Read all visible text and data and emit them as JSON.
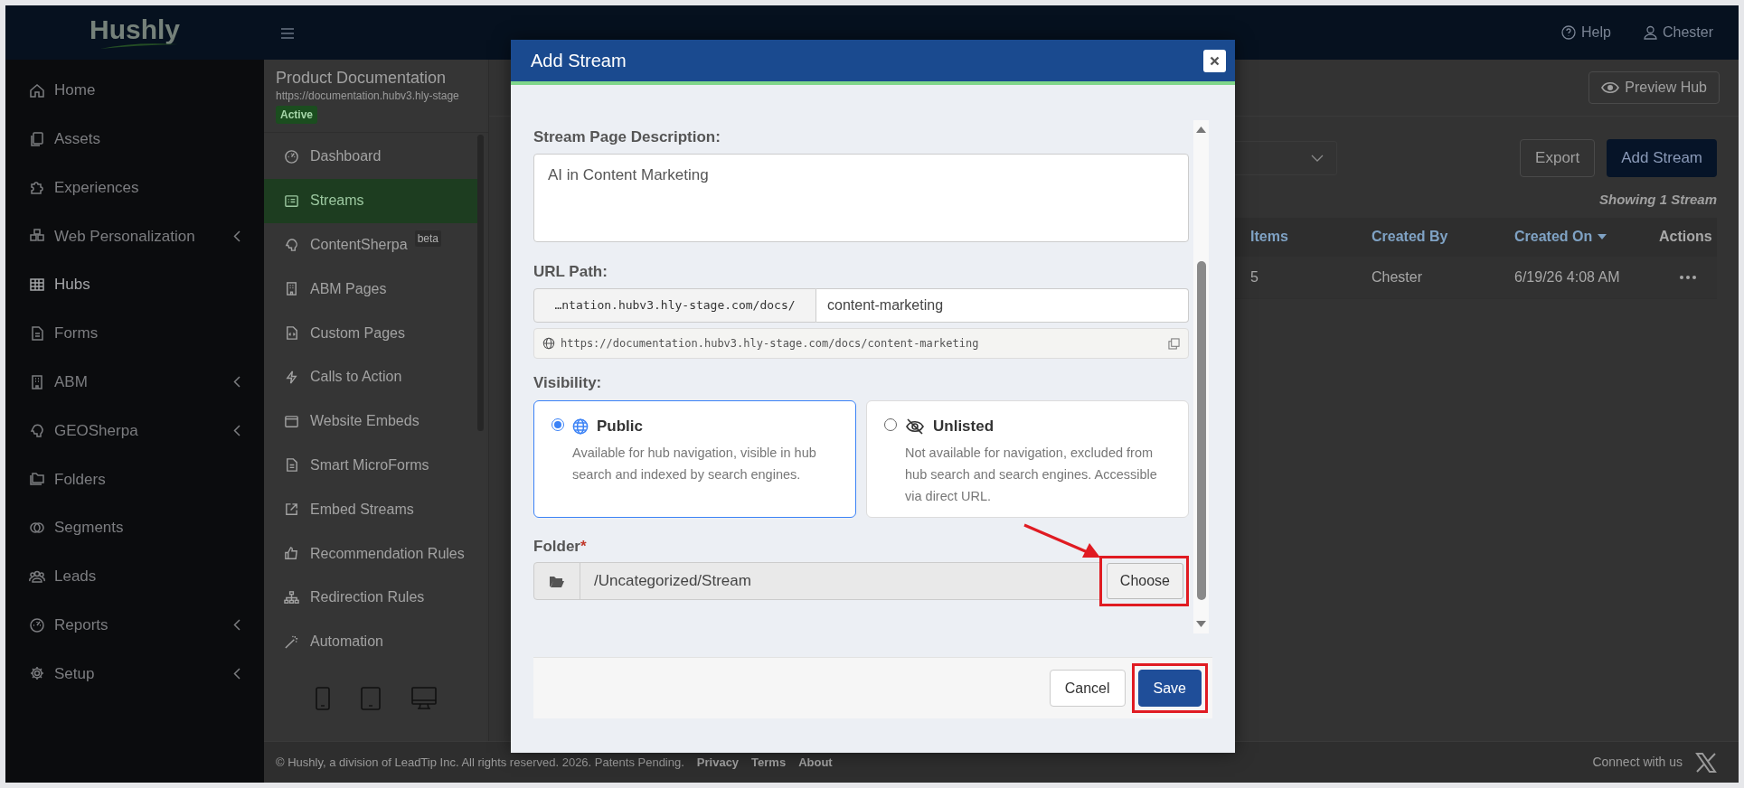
{
  "logo": {
    "text": "Hushly"
  },
  "nav": [
    {
      "label": "Home",
      "selected": false,
      "has_submenu": false
    },
    {
      "label": "Assets",
      "selected": false,
      "has_submenu": false
    },
    {
      "label": "Experiences",
      "selected": false,
      "has_submenu": false
    },
    {
      "label": "Web Personalization",
      "selected": false,
      "has_submenu": true
    },
    {
      "label": "Hubs",
      "selected": true,
      "has_submenu": false
    },
    {
      "label": "Forms",
      "selected": false,
      "has_submenu": false
    },
    {
      "label": "ABM",
      "selected": false,
      "has_submenu": true
    },
    {
      "label": "GEOSherpa",
      "selected": false,
      "has_submenu": true
    },
    {
      "label": "Folders",
      "selected": false,
      "has_submenu": false
    },
    {
      "label": "Segments",
      "selected": false,
      "has_submenu": false
    },
    {
      "label": "Leads",
      "selected": false,
      "has_submenu": false
    },
    {
      "label": "Reports",
      "selected": false,
      "has_submenu": true
    },
    {
      "label": "Setup",
      "selected": false,
      "has_submenu": true
    }
  ],
  "topbar": {
    "help": "Help",
    "user": "Chester"
  },
  "hub": {
    "title": "Product Documentation",
    "url": "https://documentation.hubv3.hly-stage",
    "status": "Active"
  },
  "hub_nav": [
    {
      "label": "Dashboard",
      "selected": false
    },
    {
      "label": "Streams",
      "selected": true
    },
    {
      "label": "ContentSherpa",
      "selected": false,
      "badge": "beta"
    },
    {
      "label": "ABM Pages",
      "selected": false
    },
    {
      "label": "Custom Pages",
      "selected": false
    },
    {
      "label": "Calls to Action",
      "selected": false
    },
    {
      "label": "Website Embeds",
      "selected": false
    },
    {
      "label": "Smart MicroForms",
      "selected": false
    },
    {
      "label": "Embed Streams",
      "selected": false
    },
    {
      "label": "Recommendation Rules",
      "selected": false
    },
    {
      "label": "Redirection Rules",
      "selected": false
    },
    {
      "label": "Automation",
      "selected": false
    }
  ],
  "device_previews": [
    {
      "kind": "phone"
    },
    {
      "kind": "tablet"
    },
    {
      "kind": "desktop"
    }
  ],
  "main": {
    "preview_button": "Preview Hub",
    "export_button": "Export",
    "add_button": "Add Stream",
    "count": "Showing 1 Stream"
  },
  "table": {
    "columns": [
      {
        "label": "Items",
        "sortable": true,
        "sorted": false
      },
      {
        "label": "Created By",
        "sortable": true,
        "sorted": false
      },
      {
        "label": "Created On",
        "sortable": true,
        "sorted": true
      },
      {
        "label": "Actions",
        "sortable": false
      }
    ],
    "rows": [
      {
        "cells": [
          "5",
          "Chester",
          "6/19/26 4:08 AM"
        ]
      }
    ]
  },
  "modal": {
    "title": "Add Stream",
    "description": {
      "label": "Stream Page Description:",
      "value": "AI in Content Marketing"
    },
    "url_path": {
      "label": "URL Path:",
      "prefix": "…ntation.hubv3.hly-stage.com/docs/",
      "value": "content-marketing",
      "preview": "https://documentation.hubv3.hly-stage.com/docs/content-marketing"
    },
    "visibility": {
      "label": "Visibility:",
      "options": [
        {
          "kind": "public",
          "title": "Public",
          "description": "Available for hub navigation, visible in hub search and indexed by search engines.",
          "selected": true
        },
        {
          "kind": "unlisted",
          "title": "Unlisted",
          "description": "Not available for navigation, excluded from hub search and search engines. Accessible via direct URL.",
          "selected": false
        }
      ]
    },
    "folder": {
      "label": "Folder",
      "required_mark": "*",
      "value": "/Uncategorized/Stream",
      "button": {
        "label": "Choose",
        "highlighted": true,
        "pointed": true
      }
    },
    "buttons": [
      {
        "kind": "secondary",
        "label": "Cancel",
        "highlighted": false
      },
      {
        "kind": "primary",
        "label": "Save",
        "highlighted": true
      }
    ]
  },
  "footer": {
    "copyright": "© Hushly, a division of LeadTip Inc. All rights reserved. 2026. Patents Pending.",
    "links": [
      "Privacy",
      "Terms",
      "About"
    ],
    "social_label": "Connect with us"
  }
}
